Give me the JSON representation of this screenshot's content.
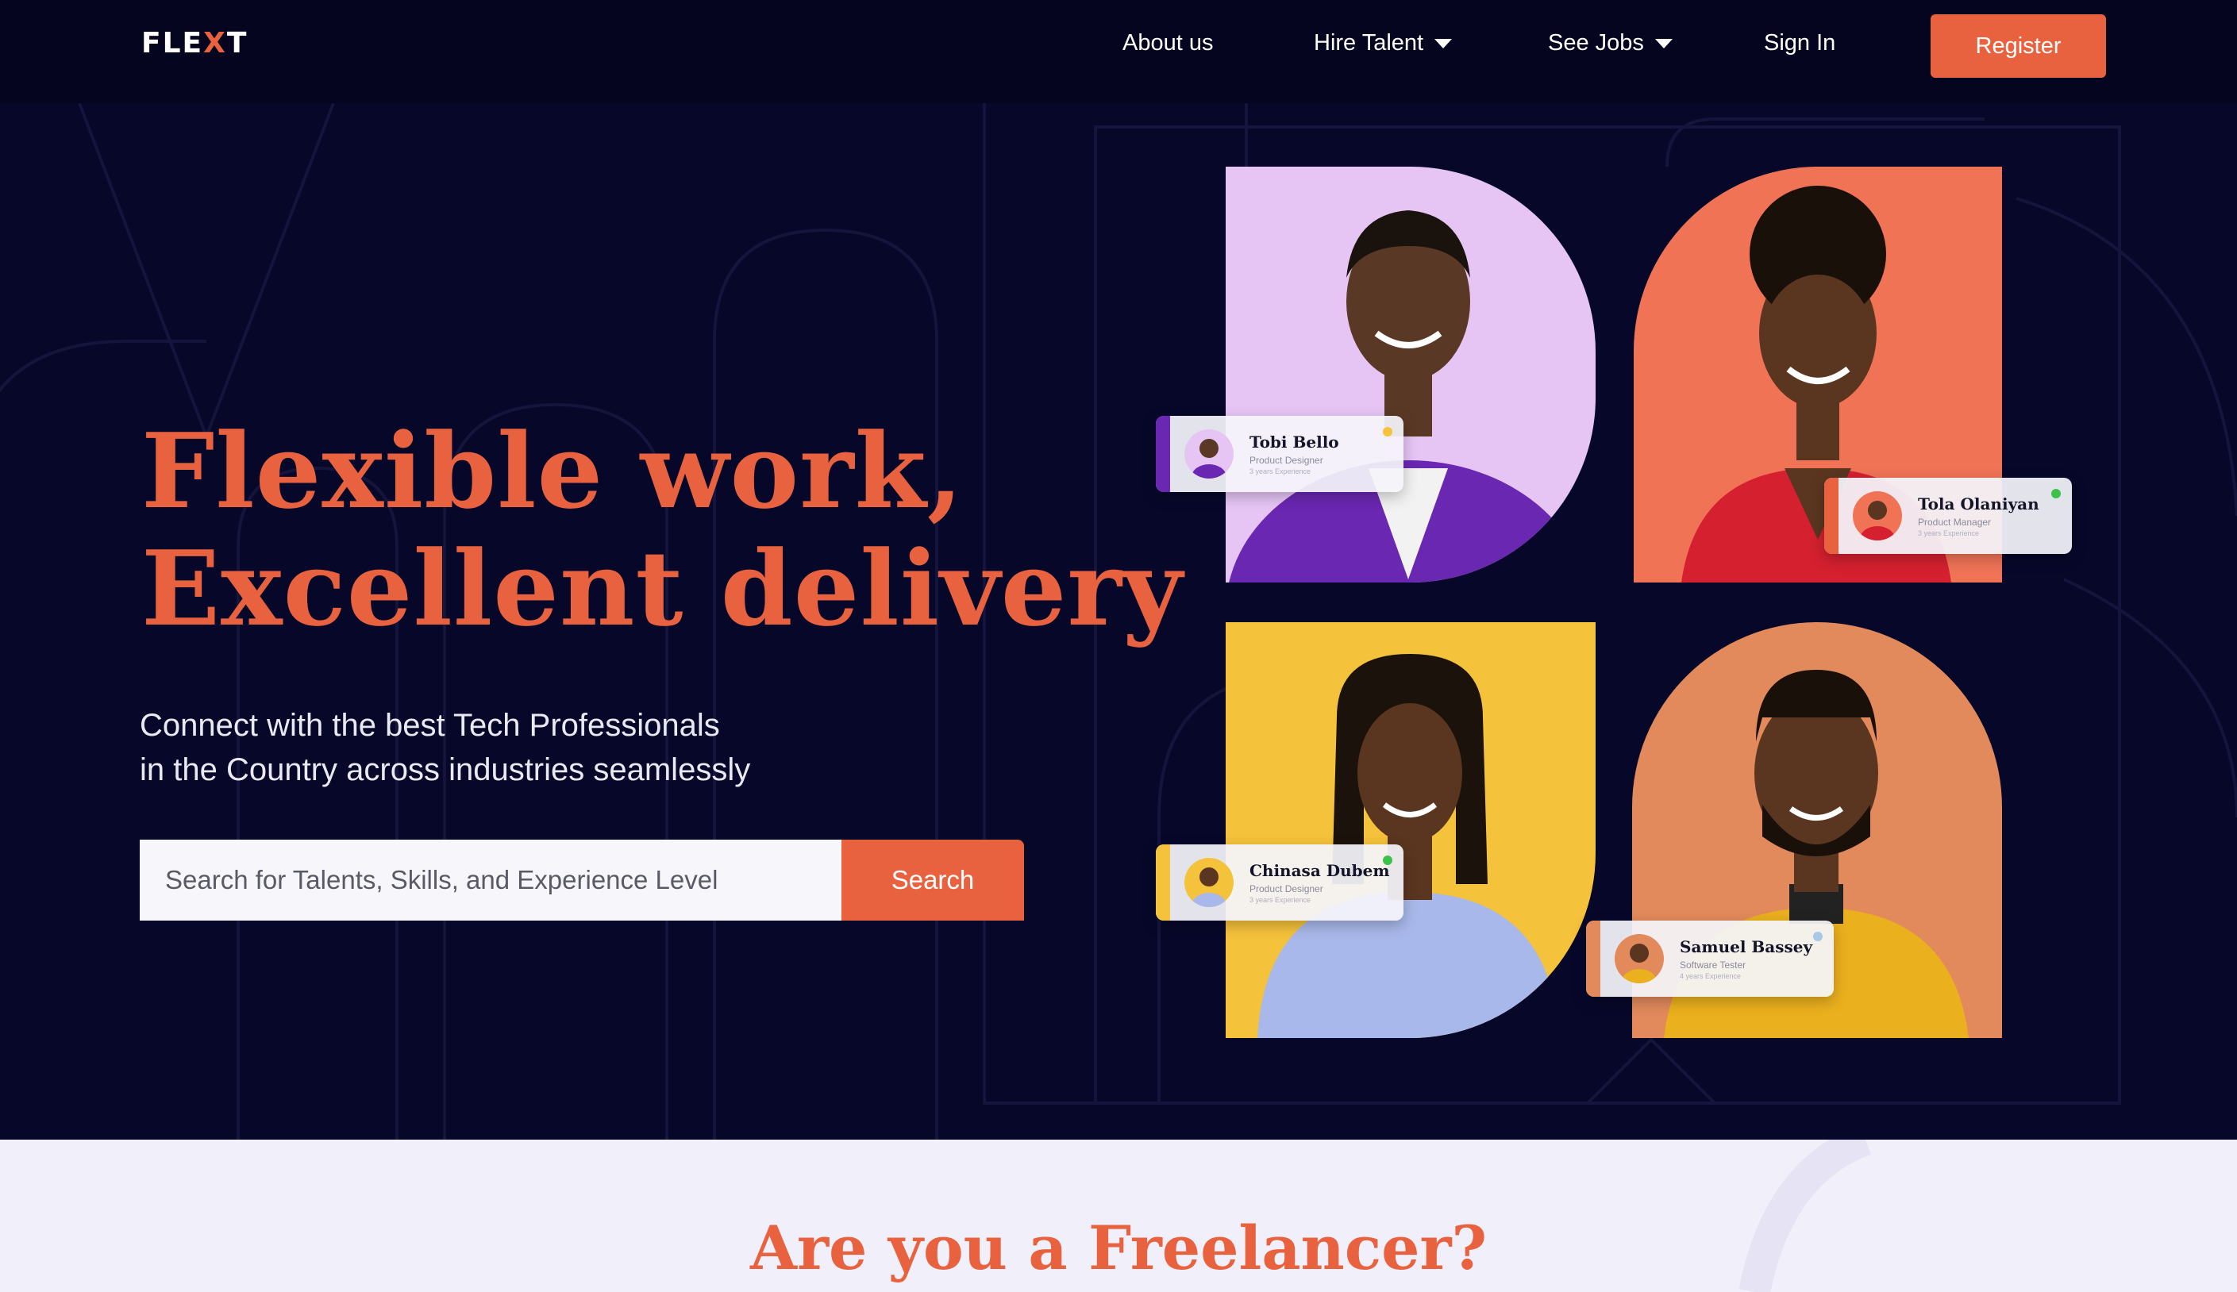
{
  "header": {
    "logo_prefix": "FLE",
    "logo_mark": "X",
    "logo_suffix": "T",
    "nav": [
      {
        "label": "About us",
        "has_dropdown": false
      },
      {
        "label": "Hire Talent",
        "has_dropdown": true
      },
      {
        "label": "See Jobs",
        "has_dropdown": true
      },
      {
        "label": "Sign In",
        "has_dropdown": false
      }
    ],
    "register_label": "Register"
  },
  "hero": {
    "headline_line1": "Flexible work,",
    "headline_line2": "Excellent delivery",
    "subtext_line1": "Connect with the best Tech Professionals",
    "subtext_line2": "in the Country across industries seamlessly",
    "search_placeholder": "Search for Talents, Skills, and Experience Level",
    "search_button": "Search"
  },
  "talents": [
    {
      "name": "Tobi Bello",
      "role": "Product Designer",
      "experience": "3 years Experience",
      "bg": "#e6c5f5",
      "accent": "#6a27b2",
      "status": "#f5c33b"
    },
    {
      "name": "Tola Olaniyan",
      "role": "Product Manager",
      "experience": "3 years Experience",
      "bg": "#f07356",
      "accent": "#e8623f",
      "status": "#3cc24a"
    },
    {
      "name": "Chinasa Dubem",
      "role": "Product Designer",
      "experience": "3 years Experience",
      "bg": "#f5c23b",
      "accent": "#f5c23b",
      "status": "#3cc24a"
    },
    {
      "name": "Samuel Bassey",
      "role": "Software Tester",
      "experience": "4 years Experience",
      "bg": "#e28a5c",
      "accent": "#e28a5c",
      "status": "#a8c8e8"
    }
  ],
  "freelancer_section": {
    "title": "Are you a Freelancer?"
  },
  "colors": {
    "brand": "#e8623f",
    "background": "#07072a",
    "section_bg": "#f1f0fa"
  }
}
